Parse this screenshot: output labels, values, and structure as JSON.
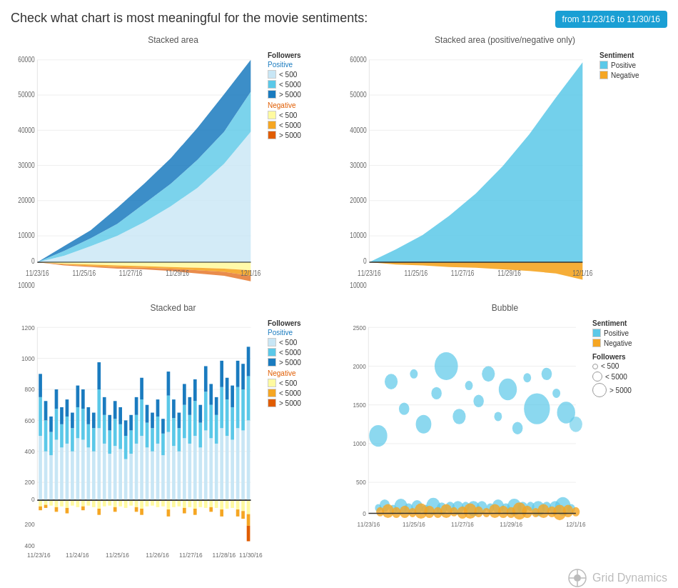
{
  "header": {
    "title": "Check what chart is most meaningful for the movie sentiments:",
    "date_range": "from 11/23/16 to 11/30/16"
  },
  "charts": {
    "stacked_area": {
      "title": "Stacked area",
      "y_max": 60000,
      "y_min": -10000,
      "legend": {
        "title": "Followers",
        "positive_label": "Positive",
        "negative_label": "Negative",
        "items": [
          {
            "label": "< 500",
            "color": "#c8e6f5"
          },
          {
            "label": "< 5000",
            "color": "#5bc8e8"
          },
          {
            "label": "> 5000",
            "color": "#1a7bbf"
          },
          {
            "label": "< 500",
            "color": "#fffaa0"
          },
          {
            "label": "< 5000",
            "color": "#f5a623"
          },
          {
            "label": "> 5000",
            "color": "#e05c00"
          }
        ]
      }
    },
    "stacked_area_2": {
      "title": "Stacked area (positive/negative only)",
      "legend": {
        "title": "Sentiment",
        "items": [
          {
            "label": "Positive",
            "color": "#5bc8e8"
          },
          {
            "label": "Negative",
            "color": "#f5a623"
          }
        ]
      }
    },
    "stacked_bar": {
      "title": "Stacked bar",
      "legend": {
        "title": "Followers",
        "positive_label": "Positive",
        "negative_label": "Negative",
        "items": [
          {
            "label": "< 500",
            "color": "#c8e6f5"
          },
          {
            "label": "< 5000",
            "color": "#5bc8e8"
          },
          {
            "label": "> 5000",
            "color": "#1a7bbf"
          },
          {
            "label": "< 500",
            "color": "#fffaa0"
          },
          {
            "label": "< 5000",
            "color": "#f5a623"
          },
          {
            "label": "> 5000",
            "color": "#e05c00"
          }
        ]
      }
    },
    "bubble": {
      "title": "Bubble",
      "legend": {
        "sentiment_title": "Sentiment",
        "items": [
          {
            "label": "Positive",
            "color": "#5bc8e8"
          },
          {
            "label": "Negative",
            "color": "#f5a623"
          }
        ],
        "followers_title": "Followers",
        "size_items": [
          {
            "label": "< 500",
            "size": 6
          },
          {
            "label": "< 5000",
            "size": 10
          },
          {
            "label": "> 5000",
            "size": 16
          }
        ]
      }
    }
  },
  "x_labels": [
    "11/23/16",
    "11/25/16",
    "11/27/16",
    "11/29/16",
    "12/1/16"
  ],
  "brand": "Grid Dynamics"
}
